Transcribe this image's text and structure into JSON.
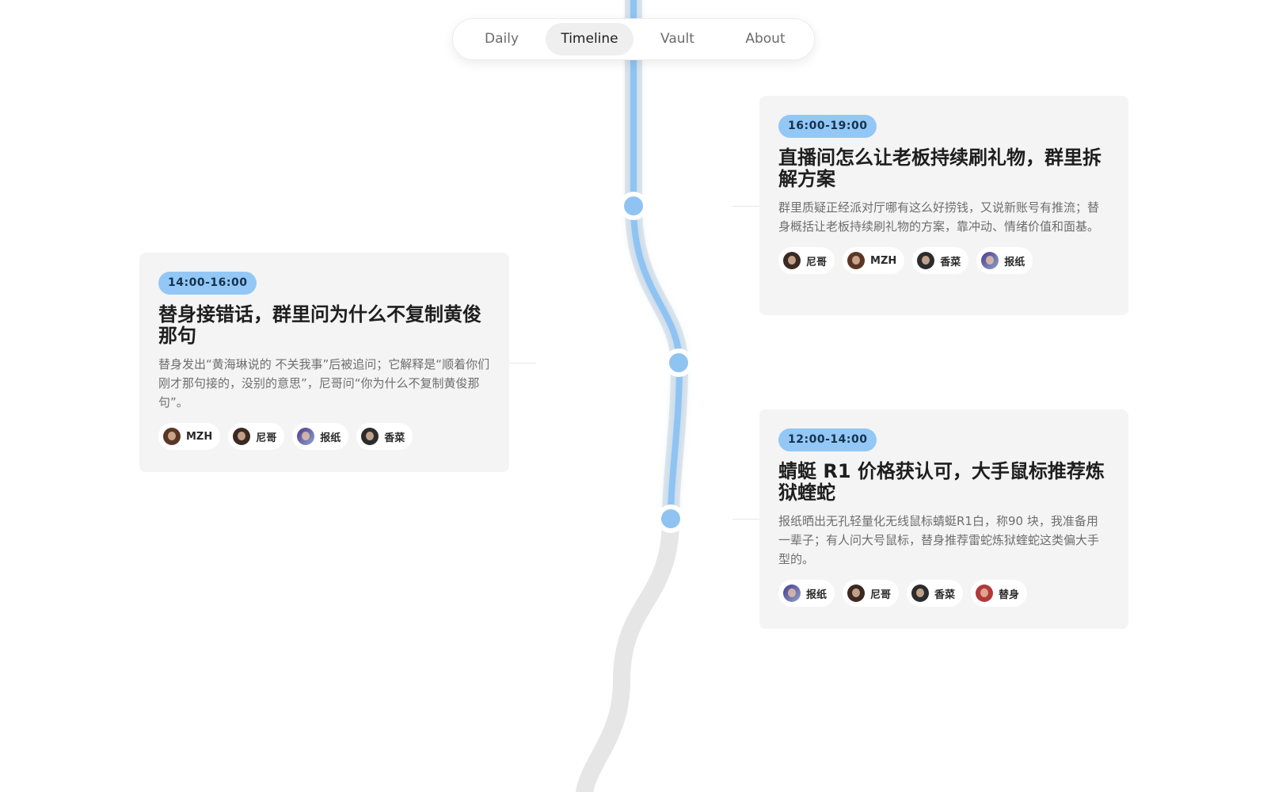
{
  "nav": {
    "tabs": [
      {
        "label": "Daily",
        "active": false
      },
      {
        "label": "Timeline",
        "active": true
      },
      {
        "label": "Vault",
        "active": false
      },
      {
        "label": "About",
        "active": false
      }
    ]
  },
  "colors": {
    "accent": "#93c7f5",
    "track_active": "#8fc3f2",
    "track_inactive": "#e6e6e6",
    "card_bg": "#f4f4f4"
  },
  "events": [
    {
      "time": "16:00-19:00",
      "title": "直播间怎么让老板持续刷礼物，群里拆解方案",
      "desc": "群里质疑正经派对厅哪有这么好捞钱，又说新账号有推流；替身概括让老板持续刷礼物的方案，靠冲动、情绪价值和面基。",
      "participants": [
        {
          "name": "尼哥",
          "avatar": "avatar-nige"
        },
        {
          "name": "MZH",
          "avatar": "avatar-mzh"
        },
        {
          "name": "香菜",
          "avatar": "avatar-xiangcai"
        },
        {
          "name": "报纸",
          "avatar": "avatar-baozhi"
        }
      ]
    },
    {
      "time": "14:00-16:00",
      "title": "替身接错话，群里问为什么不复制黄俊那句",
      "desc": "替身发出“黄海琳说的 不关我事”后被追问；它解释是“顺着你们刚才那句接的，没别的意思”，尼哥问“你为什么不复制黄俊那句”。",
      "participants": [
        {
          "name": "MZH",
          "avatar": "avatar-mzh"
        },
        {
          "name": "尼哥",
          "avatar": "avatar-nige"
        },
        {
          "name": "报纸",
          "avatar": "avatar-baozhi"
        },
        {
          "name": "香菜",
          "avatar": "avatar-xiangcai"
        }
      ]
    },
    {
      "time": "12:00-14:00",
      "title": "蜻蜓 R1 价格获认可，大手鼠标推荐炼狱蝰蛇",
      "desc": "报纸晒出无孔轻量化无线鼠标蜻蜓R1白，称90 块，我准备用一辈子；有人问大号鼠标，替身推荐雷蛇炼狱蝰蛇这类偏大手型的。",
      "participants": [
        {
          "name": "报纸",
          "avatar": "avatar-baozhi"
        },
        {
          "name": "尼哥",
          "avatar": "avatar-nige"
        },
        {
          "name": "香菜",
          "avatar": "avatar-xiangcai"
        },
        {
          "name": "替身",
          "avatar": "avatar-tishen"
        }
      ]
    }
  ]
}
